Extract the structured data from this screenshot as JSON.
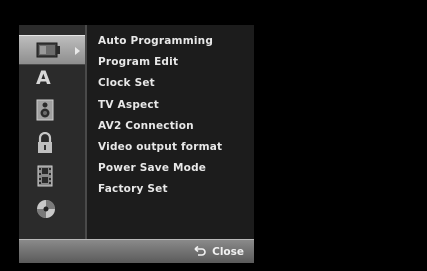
{
  "sidebar": {
    "icons": [
      {
        "name": "setup-general-icon",
        "active": true
      },
      {
        "name": "language-icon",
        "active": false
      },
      {
        "name": "audio-speaker-icon",
        "active": false
      },
      {
        "name": "lock-icon",
        "active": false
      },
      {
        "name": "film-recording-icon",
        "active": false
      },
      {
        "name": "disc-icon",
        "active": false
      }
    ],
    "language_glyph": "A"
  },
  "menu": {
    "items": [
      {
        "label": "Auto Programming"
      },
      {
        "label": "Program Edit"
      },
      {
        "label": "Clock Set"
      },
      {
        "label": "TV Aspect"
      },
      {
        "label": "AV2 Connection"
      },
      {
        "label": "Video output format"
      },
      {
        "label": "Power Save Mode"
      },
      {
        "label": "Factory Set"
      }
    ]
  },
  "footer": {
    "close_label": "Close",
    "close_icon": "return-arrow-icon"
  },
  "colors": {
    "background": "#000000",
    "panel": "#1c1c1c",
    "icon_column": "#2b2b2b",
    "active_highlight": "#a8a8a8",
    "text": "#e8e8e8"
  }
}
